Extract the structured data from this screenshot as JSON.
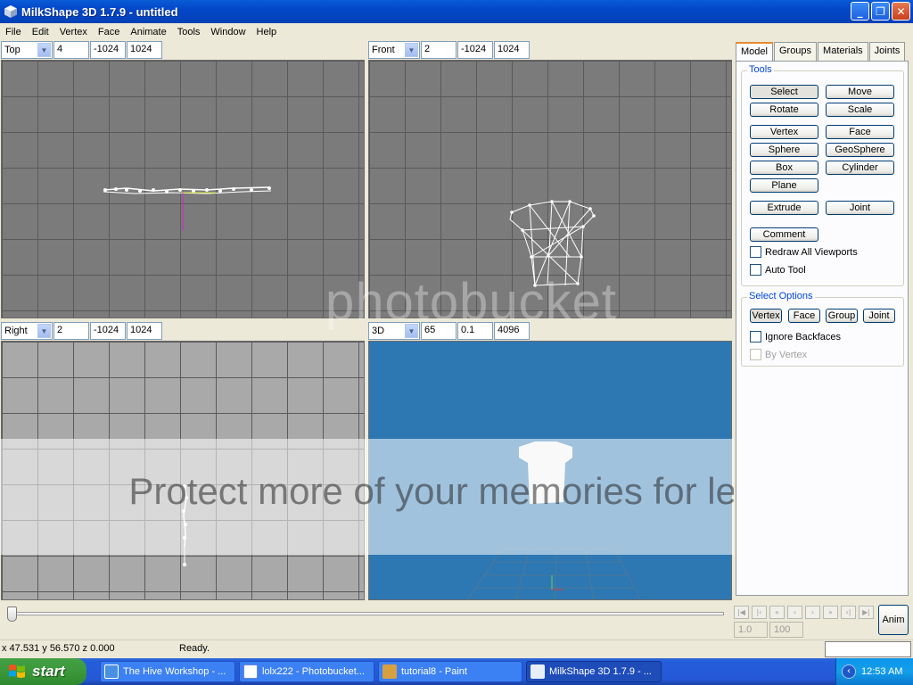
{
  "window": {
    "title": "MilkShape 3D 1.7.9 - untitled",
    "icon": "milkshape-cube-icon"
  },
  "menu": [
    "File",
    "Edit",
    "Vertex",
    "Face",
    "Animate",
    "Tools",
    "Window",
    "Help"
  ],
  "viewports": [
    {
      "view": "Top",
      "a": "4",
      "b": "-1024",
      "c": "1024"
    },
    {
      "view": "Front",
      "a": "2",
      "b": "-1024",
      "c": "1024"
    },
    {
      "view": "Right",
      "a": "2",
      "b": "-1024",
      "c": "1024"
    },
    {
      "view": "3D",
      "a": "65",
      "b": "0.1",
      "c": "4096"
    }
  ],
  "tabs": [
    "Model",
    "Groups",
    "Materials",
    "Joints"
  ],
  "tools": {
    "legend": "Tools",
    "buttons": [
      "Select",
      "Move",
      "Rotate",
      "Scale",
      "Vertex",
      "Face",
      "Sphere",
      "GeoSphere",
      "Box",
      "Cylinder",
      "Plane",
      "Extrude",
      "Joint",
      "Comment"
    ],
    "redraw_all": "Redraw All Viewports",
    "auto_tool": "Auto Tool"
  },
  "select_options": {
    "legend": "Select Options",
    "buttons": [
      "Vertex",
      "Face",
      "Group",
      "Joint"
    ],
    "ignore_backfaces": "Ignore Backfaces",
    "by_vertex": "By Vertex"
  },
  "timeline": {
    "start_frame": "1.0",
    "end_frame": "100",
    "anim_label": "Anim"
  },
  "status": {
    "coords": "x 47.531 y 56.570 z 0.000",
    "text": "Ready."
  },
  "taskbar": {
    "start": "start",
    "items": [
      "The Hive Workshop - ...",
      "lolx222 - Photobucket...",
      "tutorial8 - Paint",
      "MilkShape 3D 1.7.9 - ..."
    ],
    "clock": "12:53 AM"
  },
  "watermark": {
    "brand": "photobucket",
    "tagline": "Protect more of your memories for less!"
  },
  "colors": {
    "titlebar": "#0347c9",
    "viewport_bg": "#7b7b7b",
    "view3d_bg": "#2d78b3",
    "legend_blue": "#0046d5"
  }
}
